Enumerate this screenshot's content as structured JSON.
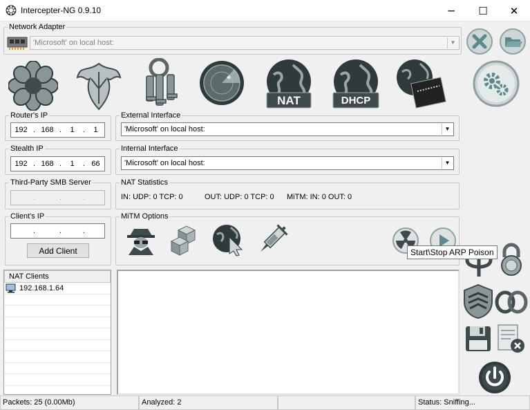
{
  "window": {
    "title": "Intercepter-NG 0.9.10",
    "minimize": "─",
    "maximize": "☐",
    "close": "✕"
  },
  "network_adapter": {
    "legend": "Network Adapter",
    "value": "'Microsoft' on local host:"
  },
  "routers_ip": {
    "legend": "Router's IP",
    "octets": [
      "192",
      "168",
      "1",
      "1"
    ]
  },
  "stealth_ip": {
    "legend": "Stealth IP",
    "octets": [
      "192",
      "168",
      "1",
      "66"
    ]
  },
  "smb_server": {
    "legend": "Third-Party SMB Server"
  },
  "clients_ip": {
    "legend": "Client's IP",
    "add_button": "Add Client"
  },
  "external_interface": {
    "legend": "External Interface",
    "value": "'Microsoft' on local host:"
  },
  "internal_interface": {
    "legend": "Internal Interface",
    "value": "'Microsoft' on local host:"
  },
  "nat_statistics": {
    "legend": "NAT Statistics",
    "in": "IN: UDP: 0 TCP: 0",
    "out": "OUT: UDP: 0 TCP: 0",
    "mitm": "MiTM: IN: 0 OUT: 0"
  },
  "mitm_options": {
    "legend": "MiTM Options"
  },
  "toolbar": {
    "nat_label": "NAT",
    "dhcp_label": "DHCP"
  },
  "tooltip": "Start\\Stop ARP Poison",
  "nat_clients": {
    "header": "NAT Clients",
    "items": [
      "192.168.1.64"
    ]
  },
  "status": {
    "packets": "Packets: 25 (0.00Mb)",
    "analyzed": "Analyzed: 2",
    "empty": "",
    "status": "Status: Sniffing..."
  },
  "colors": {
    "accent_teal": "#5a8a8e",
    "dark_icon": "#2f3a3c"
  }
}
